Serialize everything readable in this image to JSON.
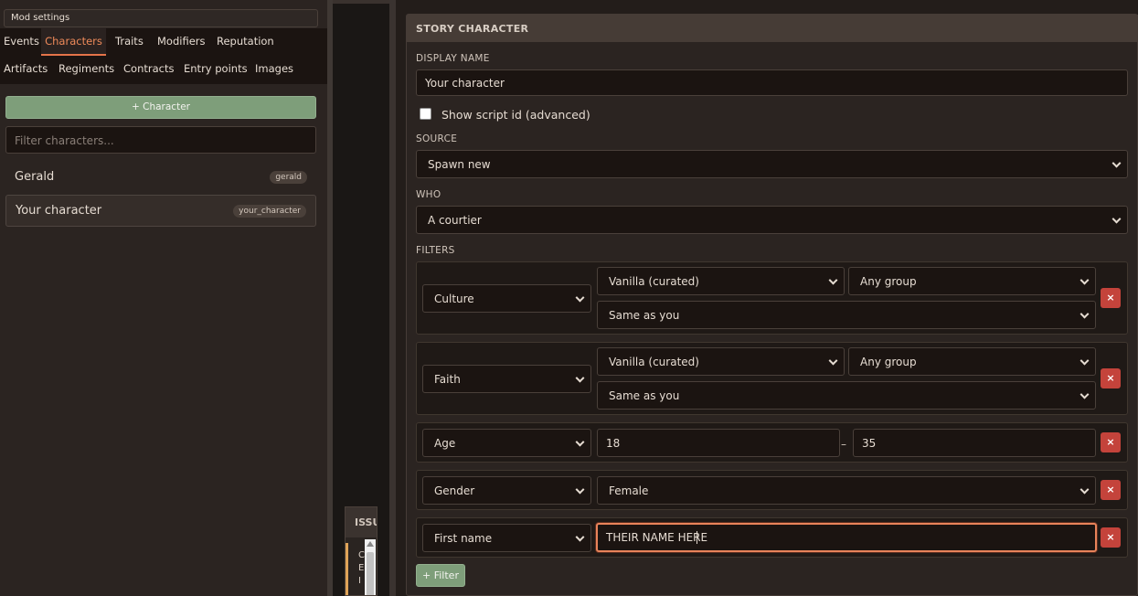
{
  "sidebar": {
    "mod_settings": "Mod settings",
    "tabs_row1": [
      "Events",
      "Characters",
      "Traits",
      "Modifiers",
      "Reputation"
    ],
    "tabs_row2": [
      "Artifacts",
      "Regiments",
      "Contracts",
      "Entry points",
      "Images"
    ],
    "active_tab": "Characters",
    "add_character_label": "+ Character",
    "filter_placeholder": "Filter characters...",
    "characters": [
      {
        "name": "Gerald",
        "id": "gerald"
      },
      {
        "name": "Your character",
        "id": "your_character",
        "selected": true
      }
    ]
  },
  "issues": {
    "header": "ISSU",
    "preview": "C E I"
  },
  "editor": {
    "header": "STORY CHARACTER",
    "display_name_label": "DISPLAY NAME",
    "display_name_value": "Your character",
    "show_script_id_label": "Show script id (advanced)",
    "show_script_id_checked": false,
    "source_label": "SOURCE",
    "source_value": "Spawn new",
    "who_label": "WHO",
    "who_value": "A courtier",
    "filters_label": "FILTERS",
    "filters": {
      "culture": {
        "type": "Culture",
        "set": "Vanilla (curated)",
        "group": "Any group",
        "relation": "Same as you"
      },
      "faith": {
        "type": "Faith",
        "set": "Vanilla (curated)",
        "group": "Any group",
        "relation": "Same as you"
      },
      "age": {
        "type": "Age",
        "min": "18",
        "max": "35",
        "separator": "–"
      },
      "gender": {
        "type": "Gender",
        "value": "Female"
      },
      "first_name": {
        "type": "First name",
        "value": "THEIR NAME HERE"
      }
    },
    "remove_glyph": "×",
    "add_filter_label": "+ Filter"
  },
  "colors": {
    "accent": "#e4744a",
    "button_green": "#7e9e7a",
    "remove_red": "#c4433b",
    "issue_warning": "#e0a458"
  }
}
